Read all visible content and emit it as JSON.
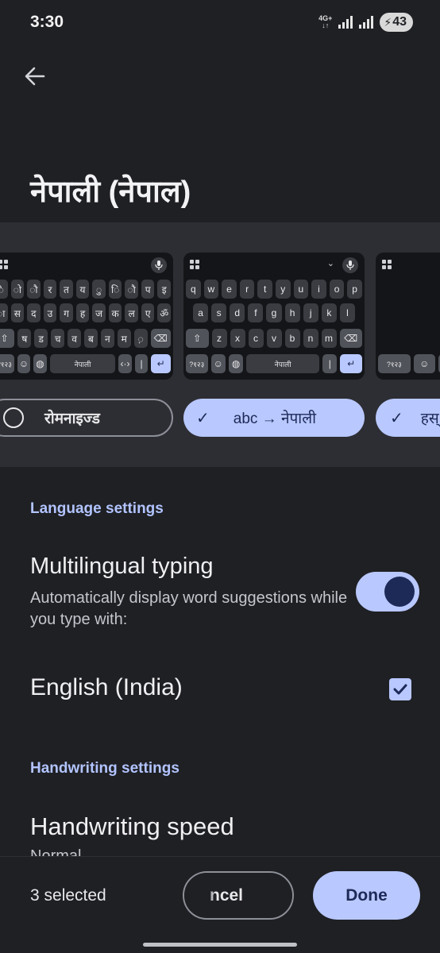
{
  "status": {
    "time": "3:30",
    "network": "4G+",
    "battery": "43"
  },
  "page": {
    "title": "नेपाली (नेपाल)"
  },
  "keyboards": {
    "devanagari": {
      "row1": [
        "ै",
        "ो",
        "ौ",
        "र",
        "त",
        "य",
        "ु",
        "ि",
        "ौ",
        "प",
        "इ"
      ],
      "row2": [
        "ा",
        "स",
        "द",
        "उ",
        "ग",
        "ह",
        "ज",
        "क",
        "ल",
        "ए",
        "ॐ"
      ],
      "row3": [
        "ष",
        "ड",
        "च",
        "व",
        "ब",
        "न",
        "म",
        "़"
      ],
      "symbols": "?१२३",
      "space": "नेपाली"
    },
    "qwerty": {
      "row1": [
        "q",
        "w",
        "e",
        "r",
        "t",
        "y",
        "u",
        "i",
        "o",
        "p"
      ],
      "row2": [
        "a",
        "s",
        "d",
        "f",
        "g",
        "h",
        "j",
        "k",
        "l"
      ],
      "row3": [
        "z",
        "x",
        "c",
        "v",
        "b",
        "n",
        "m"
      ],
      "symbols": "?१२३",
      "space": "नेपाली"
    },
    "handwriting": {
      "symbols": "?१२३"
    }
  },
  "layout_chips": {
    "romanized": "रोमनाइज्ड",
    "transliteration": "abc → नेपाली",
    "handwriting": "हस्"
  },
  "language_settings": {
    "header": "Language settings",
    "multilingual_title": "Multilingual typing",
    "multilingual_desc": "Automatically display word suggestions while you type with:",
    "multilingual_on": true,
    "english_label": "English (India)",
    "english_checked": true
  },
  "handwriting_settings": {
    "header": "Handwriting settings",
    "speed_title": "Handwriting speed",
    "speed_value": "Normal"
  },
  "bottom": {
    "selected": "3 selected",
    "cancel": "ncel",
    "done": "Done"
  },
  "colors": {
    "accent": "#b9c8ff",
    "background": "#1f2024",
    "header": "#b2c4ff"
  }
}
